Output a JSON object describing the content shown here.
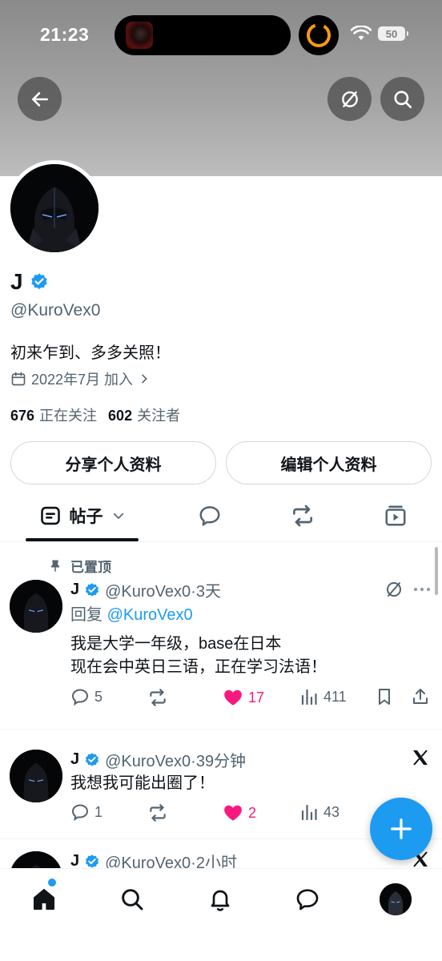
{
  "status_bar": {
    "time": "21:23",
    "battery": "50"
  },
  "profile": {
    "name": "J",
    "handle": "@KuroVex0",
    "bio": "初来乍到、多多关照！",
    "joined": "2022年7月 加入",
    "following_count": "676",
    "following_label": "正在关注",
    "followers_count": "602",
    "followers_label": "关注者",
    "share_button": "分享个人资料",
    "edit_button": "编辑个人资料"
  },
  "tabs": {
    "posts_label": "帖子"
  },
  "posts": [
    {
      "pinned_label": "已置顶",
      "name": "J",
      "meta": "@KuroVex0·3天",
      "reply_prefix": "回复",
      "reply_handle": "@KuroVex0",
      "lines": [
        "我是大学一年级，base在日本",
        "现在会中英日三语，正在学习法语！"
      ],
      "replies": "5",
      "likes": "17",
      "views": "411"
    },
    {
      "name": "J",
      "meta": "@KuroVex0·39分钟",
      "text": "我想我可能出圈了！",
      "replies": "1",
      "likes": "2",
      "views": "43"
    },
    {
      "name": "J",
      "meta": "@KuroVex0·2小时"
    }
  ],
  "colors": {
    "accent": "#1d9bf0",
    "like": "#f91880",
    "muted": "#536471"
  },
  "icons": [
    "back-arrow-icon",
    "grok-icon",
    "search-icon",
    "calendar-icon",
    "pin-icon",
    "verified-badge-icon",
    "x-logo-icon",
    "home-icon",
    "bell-icon",
    "messages-icon",
    "plus-icon"
  ]
}
